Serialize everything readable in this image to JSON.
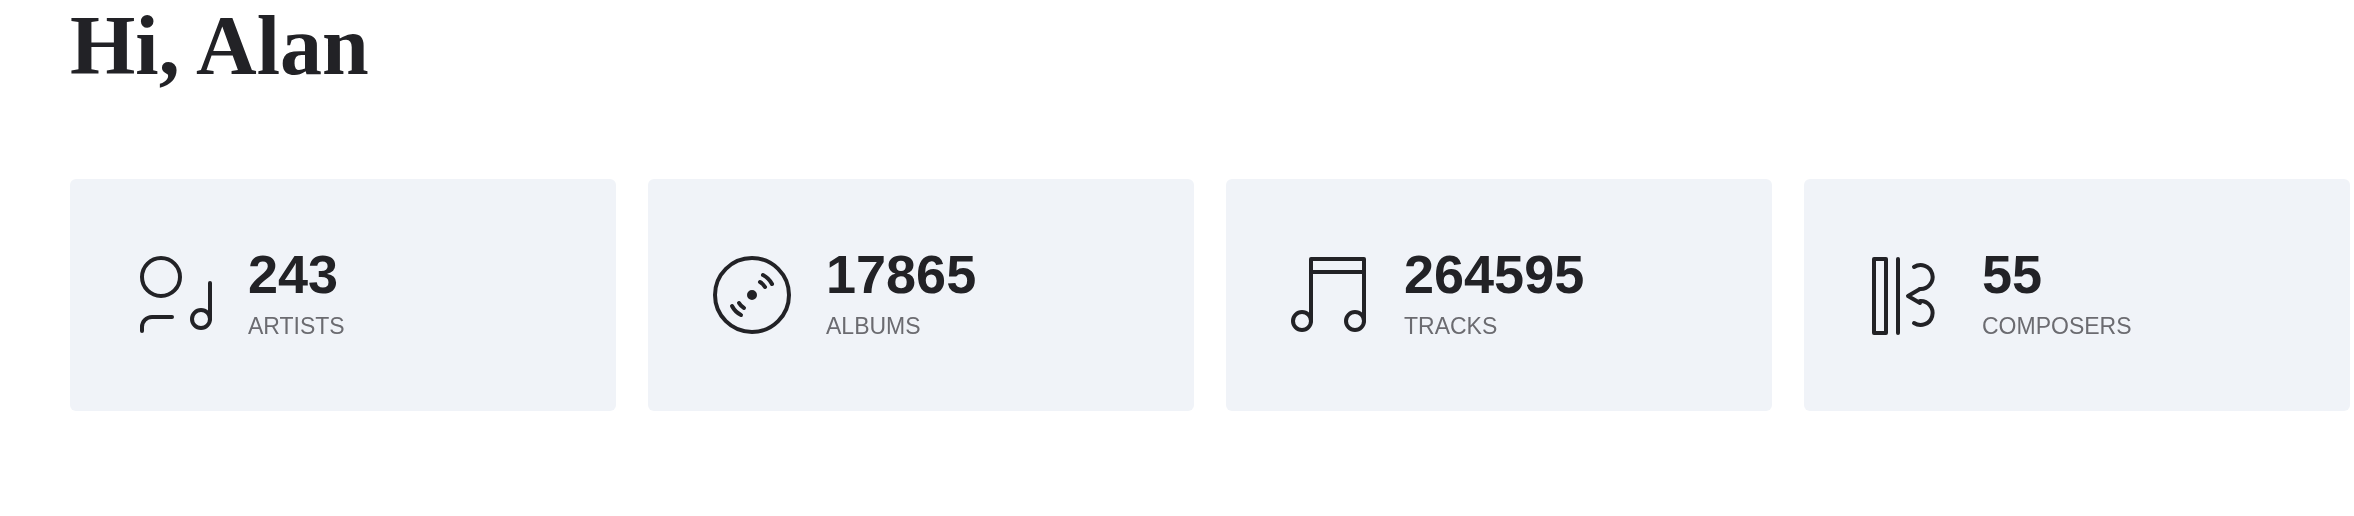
{
  "greeting": "Hi, Alan",
  "stats": [
    {
      "kind": "artists",
      "value": "243",
      "label": "ARTISTS"
    },
    {
      "kind": "albums",
      "value": "17865",
      "label": "ALBUMS"
    },
    {
      "kind": "tracks",
      "value": "264595",
      "label": "TRACKS"
    },
    {
      "kind": "composers",
      "value": "55",
      "label": "COMPOSERS"
    }
  ]
}
